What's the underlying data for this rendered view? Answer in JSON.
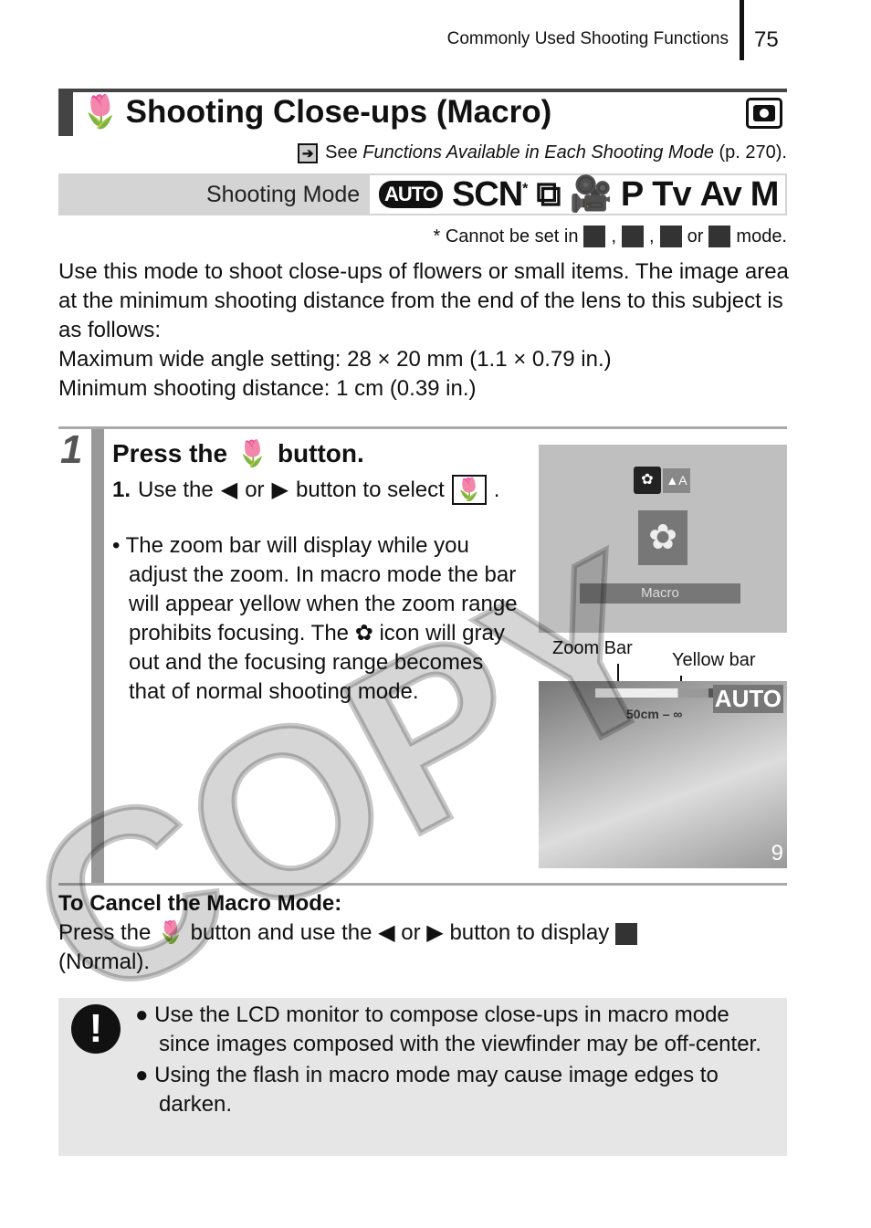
{
  "header": {
    "section": "Commonly Used Shooting Functions",
    "page": "75"
  },
  "title": {
    "text": "Shooting Close-ups (Macro)",
    "icon": "macro-tulip-icon",
    "mode_icon": "camera-icon"
  },
  "see": {
    "prefix": "See ",
    "italic": "Functions Available in Each Shooting Mode",
    "suffix": " (p. 270)."
  },
  "shooting_mode": {
    "label": "Shooting Mode",
    "modes": [
      "AUTO",
      "SCN",
      "*",
      "P",
      "Tv",
      "Av",
      "M"
    ]
  },
  "note": {
    "prefix": "* Cannot be set in",
    "sep1": ",",
    "sep2": ",",
    "or": "or",
    "suffix": "mode."
  },
  "intro": [
    "Use this mode to shoot close-ups of flowers or small items. The image area at the minimum shooting distance from the end of the lens to this subject is as follows:",
    "Maximum wide angle setting: 28 × 20 mm (1.1 × 0.79 in.)",
    "Minimum shooting distance: 1 cm (0.39 in.)"
  ],
  "step": {
    "number": "1",
    "head_a": "Press the",
    "head_b": "button.",
    "sub_num": "1.",
    "sub_a": "Use the",
    "sub_or": "or",
    "sub_b": "button to select",
    "bullet": "• The zoom bar will display while you adjust the zoom. In macro mode the bar will appear yellow when the zoom range prohibits focusing. The ✿ icon will gray out and the focusing range becomes that of normal shooting mode."
  },
  "screen1": {
    "menu_label": "Macro"
  },
  "screen2": {
    "zoom_bar_label": "Zoom Bar",
    "yellow_bar_label": "Yellow bar",
    "distance": "50cm – ∞",
    "mode": "AUTO",
    "shots": "9"
  },
  "cancel": {
    "heading": "To Cancel the Macro Mode:",
    "a": "Press the",
    "b": "button and use the",
    "or": "or",
    "c": "button to display",
    "d": "(Normal)."
  },
  "caution": {
    "icon": "exclamation-icon",
    "items": [
      "● Use the LCD monitor to compose close-ups in macro mode since images composed with the viewfinder may be off-center.",
      "● Using the flash in macro mode may cause image edges to darken."
    ]
  },
  "watermark": "COPY"
}
